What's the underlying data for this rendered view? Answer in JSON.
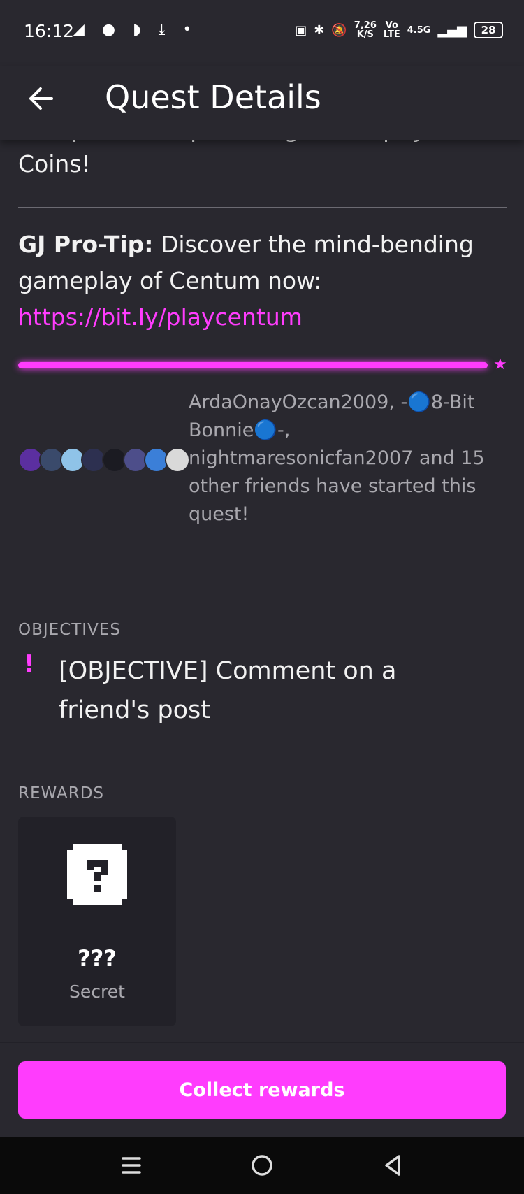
{
  "status_bar": {
    "time": "16:12",
    "left_icons": "◢ ● ◗ ⤓ •",
    "speed_top": "7,26",
    "speed_bottom": "K/S",
    "net_top": "Vo",
    "net_bottom": "LTE",
    "signal": "4.5G",
    "battery": "28"
  },
  "header": {
    "title": "Quest Details"
  },
  "quest": {
    "description": "Complete the quest to get a trophy and Coins!",
    "protip_label": "GJ Pro-Tip:",
    "protip_text": " Discover the mind-bending gameplay of Centum now: ",
    "protip_link": "https://bit.ly/playcentum",
    "progress": 1.0,
    "friends_text": "ArdaOnayOzcan2009, -🔵8-Bit Bonnie🔵-, nightmaresonicfan2007 and 15 other friends have started this quest!"
  },
  "avatar_colors": [
    "#5b2fa0",
    "#3a4a6b",
    "#8fc3e8",
    "#2d3050",
    "#1b1b22",
    "#4d4e8a",
    "#3b7fd8",
    "#d9d9d9"
  ],
  "objectives": {
    "label": "OBJECTIVES",
    "items": [
      "[OBJECTIVE] Comment on a friend's post"
    ]
  },
  "rewards": {
    "label": "REWARDS",
    "items": [
      {
        "title": "???",
        "subtitle": "Secret"
      }
    ]
  },
  "footer": {
    "collect_label": "Collect rewards"
  },
  "colors": {
    "accent": "#ff3cfd",
    "background": "#29282f",
    "card": "#222128"
  }
}
